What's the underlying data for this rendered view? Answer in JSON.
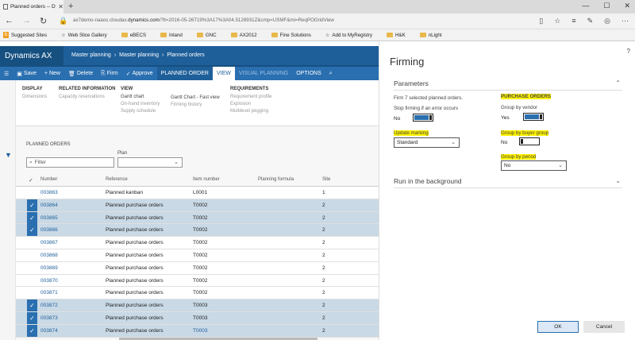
{
  "browser": {
    "tab_title": "Planned orders -- Dynar",
    "tab_close": "✕",
    "new_tab": "+",
    "url_prefix": "ax7demo-naaos.cloudax.",
    "url_domain": "dynamics.com",
    "url_rest": "/?lt=2016-05-26T19%3A17%3A04.5128931Z&cmp=USMF&mi=ReqPOGridView",
    "favorites": [
      "Suggested Sites",
      "Web Slice Gallery",
      "eBECS",
      "Inland",
      "GNC",
      "AX2012",
      "Fine Solutions",
      "Add to MyRegistry",
      "H&K",
      "nLight"
    ]
  },
  "app": {
    "brand": "Dynamics AX",
    "breadcrumb": [
      "Master planning",
      "›",
      "Master planning",
      "›",
      "Planned orders"
    ],
    "actions": [
      {
        "icon": "☰",
        "label": ""
      },
      {
        "icon": "▣",
        "label": "Save"
      },
      {
        "icon": "+",
        "label": "New"
      },
      {
        "icon": "🗑",
        "label": "Delete"
      },
      {
        "icon": "⎘",
        "label": "Firm"
      },
      {
        "icon": "✓",
        "label": "Approve"
      },
      {
        "icon": "",
        "label": "PLANNED ORDER"
      },
      {
        "icon": "",
        "label": "VIEW"
      },
      {
        "icon": "",
        "label": "VISUAL PLANNING"
      },
      {
        "icon": "",
        "label": "OPTIONS"
      },
      {
        "icon": "⌕",
        "label": ""
      }
    ]
  },
  "ribbon": {
    "groups": [
      {
        "title": "DISPLAY",
        "items": [
          "Dimensions"
        ]
      },
      {
        "title": "RELATED INFORMATION",
        "items": [
          "Capacity reservations"
        ]
      },
      {
        "title": "VIEW",
        "items": [
          "Gantt chart",
          "On-hand inventory",
          "Supply schedule"
        ]
      },
      {
        "title": "",
        "items": [
          "Gantt Chart - Fast view",
          "Firming history"
        ]
      },
      {
        "title": "REQUIREMENTS",
        "items": [
          "Requirement profile",
          "Explosion",
          "Multilevel pegging"
        ]
      }
    ]
  },
  "list": {
    "section_title": "PLANNED ORDERS",
    "plan_label": "Plan",
    "filter_placeholder": "Filter",
    "columns": [
      "Number",
      "Reference",
      "Item number",
      "Planning formula",
      "Site"
    ],
    "rows": [
      {
        "number": "003863",
        "reference": "Planned kanban",
        "item": "L0001",
        "site": "1",
        "selected": false
      },
      {
        "number": "003864",
        "reference": "Planned purchase orders",
        "item": "T0002",
        "site": "2",
        "selected": true
      },
      {
        "number": "003865",
        "reference": "Planned purchase orders",
        "item": "T0002",
        "site": "2",
        "selected": true
      },
      {
        "number": "003866",
        "reference": "Planned purchase orders",
        "item": "T0002",
        "site": "2",
        "selected": true
      },
      {
        "number": "003867",
        "reference": "Planned purchase orders",
        "item": "T0002",
        "site": "2",
        "selected": false
      },
      {
        "number": "003868",
        "reference": "Planned purchase orders",
        "item": "T0002",
        "site": "2",
        "selected": false
      },
      {
        "number": "003869",
        "reference": "Planned purchase orders",
        "item": "T0002",
        "site": "2",
        "selected": false
      },
      {
        "number": "003870",
        "reference": "Planned purchase orders",
        "item": "T0002",
        "site": "2",
        "selected": false
      },
      {
        "number": "003871",
        "reference": "Planned purchase orders",
        "item": "T0002",
        "site": "2",
        "selected": false
      },
      {
        "number": "003872",
        "reference": "Planned purchase orders",
        "item": "T0003",
        "site": "2",
        "selected": true
      },
      {
        "number": "003873",
        "reference": "Planned purchase orders",
        "item": "T0003",
        "site": "2",
        "selected": true
      },
      {
        "number": "003874",
        "reference": "Planned purchase orders",
        "item": "T0003",
        "site": "2",
        "selected": true
      }
    ]
  },
  "firming": {
    "title": "Firming",
    "help": "?",
    "parameters_label": "Parameters",
    "firm_text": "Firm 7 selected planned orders.",
    "stop_label": "Stop firming if an error occurs",
    "stop_value": "No",
    "purchase_orders_heading": "PURCHASE ORDERS",
    "group_vendor_label": "Group by vendor",
    "group_vendor_value": "Yes",
    "update_marking_label": "Update marking",
    "update_marking_value": "Standard",
    "group_buyer_label": "Group by buyer group",
    "group_buyer_value": "No",
    "group_period_label": "Group by period",
    "group_period_value": "No",
    "background_label": "Run in the background",
    "ok_label": "OK",
    "cancel_label": "Cancel"
  },
  "colors": {
    "accent": "#2a6fb0",
    "header": "#1e5f9a",
    "highlight": "#fff200"
  }
}
